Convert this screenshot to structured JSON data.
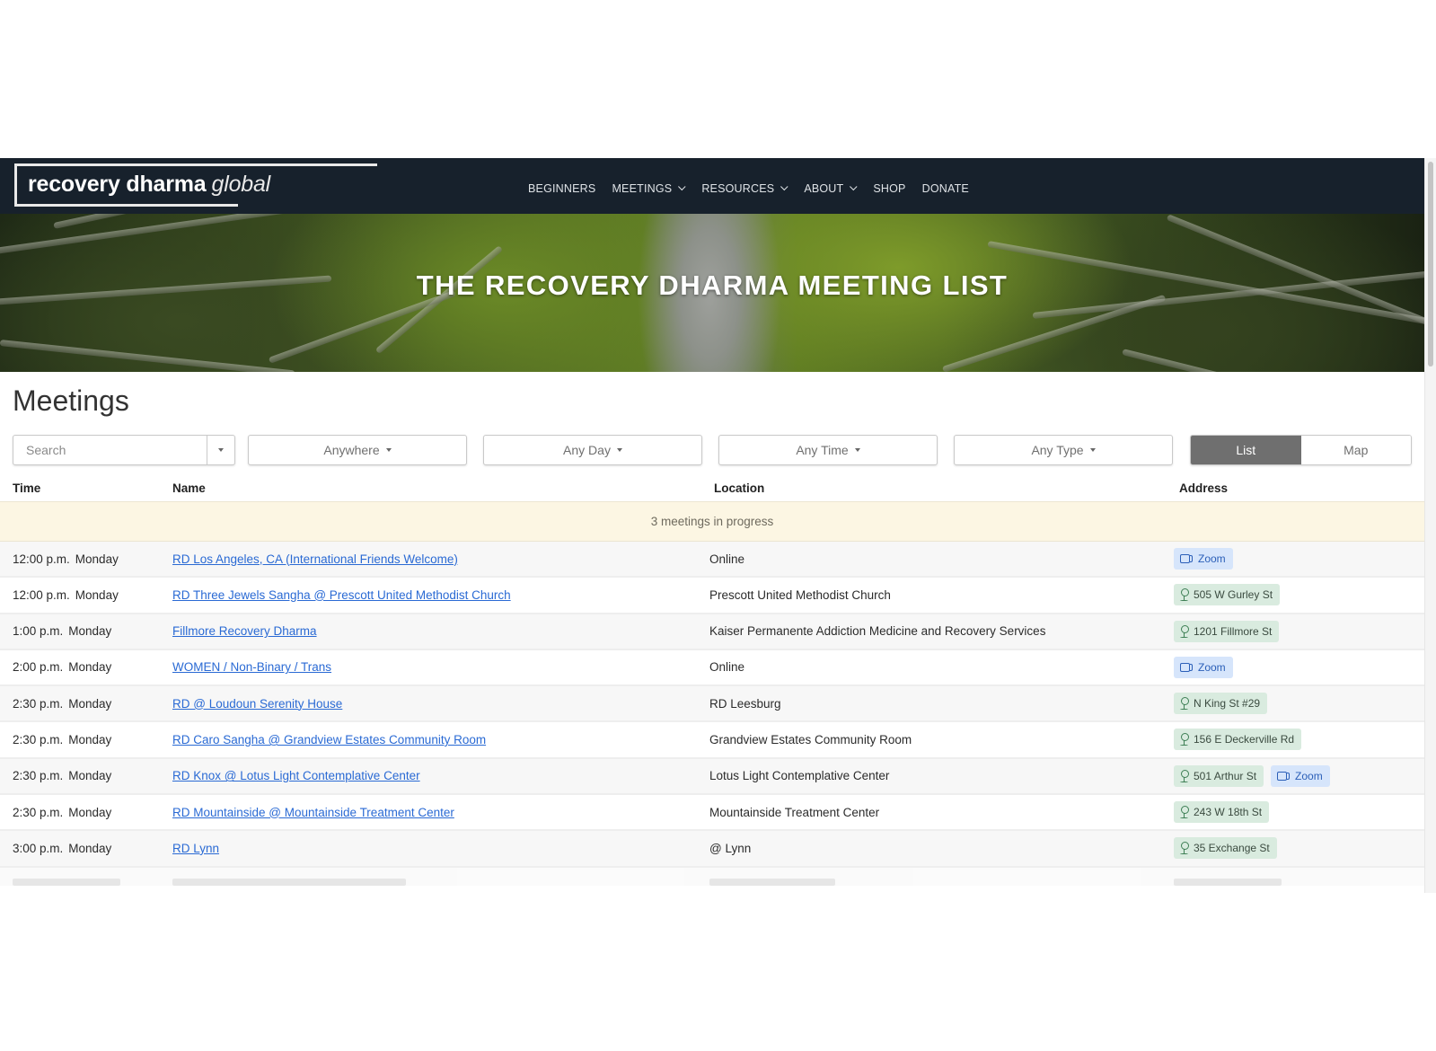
{
  "header": {
    "logo_main": "recovery dharma",
    "logo_sub": "global",
    "nav": [
      {
        "label": "BEGINNERS",
        "dropdown": false
      },
      {
        "label": "MEETINGS",
        "dropdown": true
      },
      {
        "label": "RESOURCES",
        "dropdown": true
      },
      {
        "label": "ABOUT",
        "dropdown": true
      },
      {
        "label": "SHOP",
        "dropdown": false
      },
      {
        "label": "DONATE",
        "dropdown": false
      }
    ]
  },
  "hero": {
    "title": "THE RECOVERY DHARMA MEETING LIST"
  },
  "page_title": "Meetings",
  "filters": {
    "search_placeholder": "Search",
    "region": "Anywhere",
    "day": "Any Day",
    "time": "Any Time",
    "type": "Any Type",
    "view_options": [
      {
        "label": "List",
        "active": true
      },
      {
        "label": "Map",
        "active": false
      }
    ]
  },
  "table": {
    "columns": {
      "time": "Time",
      "name": "Name",
      "location": "Location",
      "address": "Address"
    },
    "in_progress": "3 meetings in progress",
    "rows": [
      {
        "time": "12:00 p.m.",
        "day": "Monday",
        "name": "RD Los Angeles, CA (International Friends Welcome)",
        "location": "Online",
        "badges": [
          {
            "type": "online",
            "label": "Zoom"
          }
        ]
      },
      {
        "time": "12:00 p.m.",
        "day": "Monday",
        "name": "RD Three Jewels Sangha @ Prescott United Methodist Church",
        "location": "Prescott United Methodist Church",
        "badges": [
          {
            "type": "loc",
            "label": "505 W Gurley St"
          }
        ]
      },
      {
        "time": "1:00 p.m.",
        "day": "Monday",
        "name": "Fillmore Recovery Dharma",
        "location": "Kaiser Permanente Addiction Medicine and Recovery Services",
        "badges": [
          {
            "type": "loc",
            "label": "1201 Fillmore St"
          }
        ]
      },
      {
        "time": "2:00 p.m.",
        "day": "Monday",
        "name": "WOMEN / Non-Binary / Trans",
        "location": "Online",
        "badges": [
          {
            "type": "online",
            "label": "Zoom"
          }
        ]
      },
      {
        "time": "2:30 p.m.",
        "day": "Monday",
        "name": "RD @ Loudoun Serenity House",
        "location": "RD Leesburg",
        "badges": [
          {
            "type": "loc",
            "label": "N King St #29"
          }
        ]
      },
      {
        "time": "2:30 p.m.",
        "day": "Monday",
        "name": "RD Caro Sangha @ Grandview Estates Community Room",
        "location": "Grandview Estates Community Room",
        "badges": [
          {
            "type": "loc",
            "label": "156 E Deckerville Rd"
          }
        ]
      },
      {
        "time": "2:30 p.m.",
        "day": "Monday",
        "name": "RD Knox @ Lotus Light Contemplative Center",
        "location": "Lotus Light Contemplative Center",
        "badges": [
          {
            "type": "loc",
            "label": "501 Arthur St"
          },
          {
            "type": "online",
            "label": "Zoom"
          }
        ]
      },
      {
        "time": "2:30 p.m.",
        "day": "Monday",
        "name": "RD Mountainside @ Mountainside Treatment Center",
        "location": "Mountainside Treatment Center",
        "badges": [
          {
            "type": "loc",
            "label": "243 W 18th St"
          }
        ]
      },
      {
        "time": "3:00 p.m.",
        "day": "Monday",
        "name": "RD Lynn",
        "location": "@ Lynn",
        "badges": [
          {
            "type": "loc",
            "label": "35 Exchange St"
          }
        ]
      }
    ]
  },
  "colors": {
    "header_bg": "#17212c",
    "link": "#2a6ad4",
    "in_progress_bg": "#fcf6e3",
    "location_badge_bg": "#d9ebdf",
    "online_badge_bg": "#d6e5fb",
    "active_toggle": "#6f6f6f"
  }
}
